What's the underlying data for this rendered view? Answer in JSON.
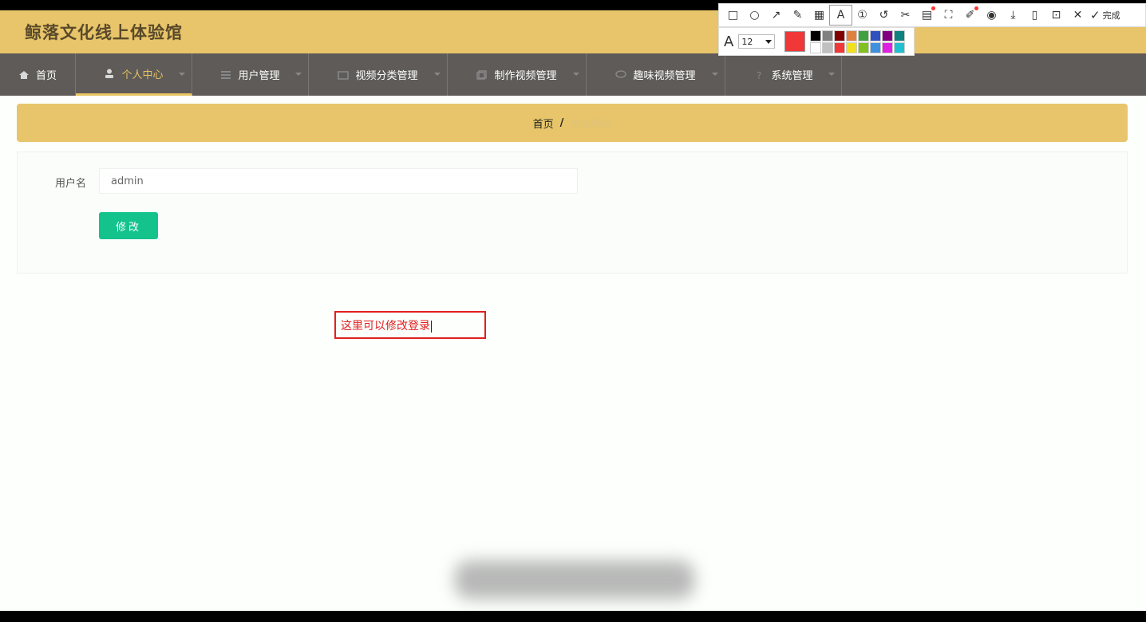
{
  "site_title": "鲸落文化线上体验馆",
  "nav": [
    {
      "label": "首页",
      "icon": "home-icon"
    },
    {
      "label": "个人中心",
      "icon": "user-icon",
      "active": true
    },
    {
      "label": "用户管理",
      "icon": "list-icon"
    },
    {
      "label": "视频分类管理",
      "icon": "folder-icon"
    },
    {
      "label": "制作视频管理",
      "icon": "copy-icon"
    },
    {
      "label": "趣味视频管理",
      "icon": "chat-icon"
    },
    {
      "label": "系统管理",
      "icon": "question-icon"
    }
  ],
  "breadcrumb": {
    "home": "首页",
    "separator": "/",
    "current": "个人中心"
  },
  "form": {
    "username_label": "用户名",
    "username_value": "admin",
    "submit_label": "修改"
  },
  "annotation": {
    "text": "这里可以修改登录",
    "color": "#e02020"
  },
  "screenshot_toolbar": {
    "tools": [
      "rectangle-icon",
      "ellipse-icon",
      "arrow-icon",
      "pencil-icon",
      "mosaic-icon",
      "text-icon",
      "number-icon",
      "undo-icon",
      "cut-icon",
      "ocr-icon",
      "crop-icon",
      "pin-icon",
      "record-icon",
      "download-icon",
      "save-icon",
      "bookmark-icon",
      "close-icon"
    ],
    "selected_tool": "text-icon",
    "done_label": "完成",
    "font_size": "12",
    "current_color": "#f03838",
    "palette": [
      "#000000",
      "#808080",
      "#800000",
      "#e08040",
      "#40a040",
      "#3050c0",
      "#800080",
      "#108080",
      "#ffffff",
      "#c0c0c0",
      "#f03838",
      "#f0e020",
      "#80c020",
      "#4090e0",
      "#e020e0",
      "#20c0d0"
    ]
  }
}
